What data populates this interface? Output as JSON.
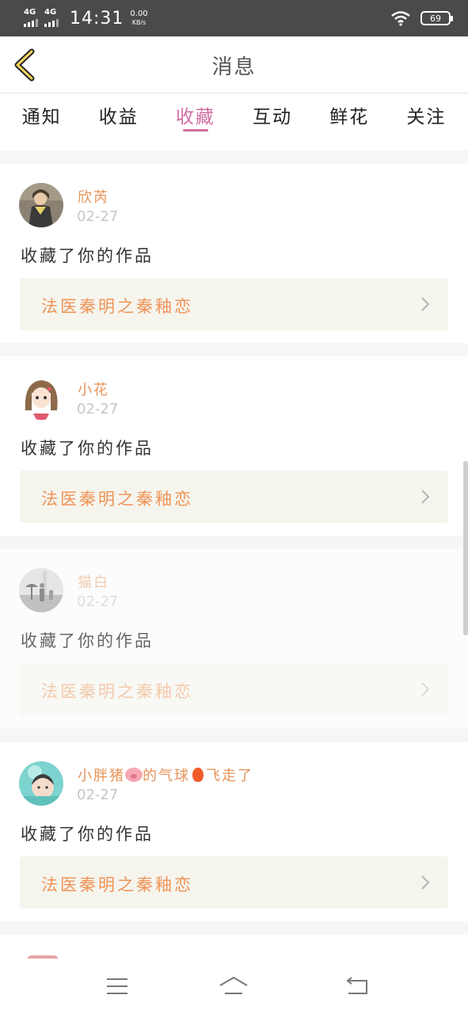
{
  "status_bar": {
    "network_1": "4G",
    "network_2": "4G",
    "time": "14:31",
    "speed_value": "0.00",
    "speed_unit": "KB/s",
    "battery": "69"
  },
  "header": {
    "title": "消息",
    "back_icon": "chevron-left-icon"
  },
  "tabs": [
    {
      "label": "通知",
      "active": false
    },
    {
      "label": "收益",
      "active": false
    },
    {
      "label": "收藏",
      "active": true
    },
    {
      "label": "互动",
      "active": false
    },
    {
      "label": "鲜花",
      "active": false
    },
    {
      "label": "关注",
      "active": false
    }
  ],
  "messages": [
    {
      "user": "欣芮",
      "date": "02-27",
      "action": "收藏了你的作品",
      "work_title": "法医秦明之秦釉恋"
    },
    {
      "user": "小花",
      "date": "02-27",
      "action": "收藏了你的作品",
      "work_title": "法医秦明之秦釉恋"
    },
    {
      "user": "猫白",
      "date": "02-27",
      "action": "收藏了你的作品",
      "work_title": "法医秦明之秦釉恋"
    },
    {
      "user_part1": "小胖猪",
      "user_part2": "的气球",
      "user_part3": "飞走了",
      "date": "02-27",
      "action": "收藏了你的作品",
      "work_title": "法医秦明之秦釉恋"
    }
  ],
  "colors": {
    "accent": "#d06ea2",
    "username": "#e7945a",
    "work_title": "#ef9356",
    "status_bar": "#4a4a4a"
  }
}
